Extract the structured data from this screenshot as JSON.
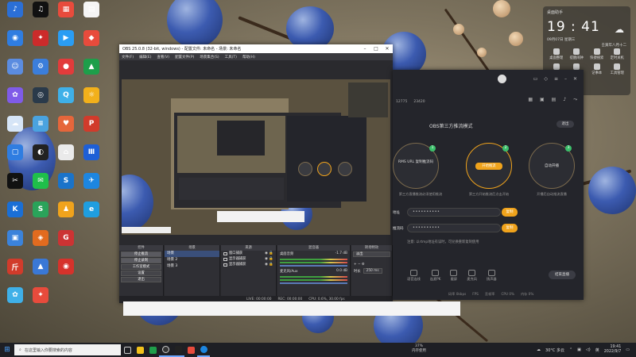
{
  "desktop_icons": [
    {
      "label": "",
      "color": "#2b6fd6",
      "glyph": "♪"
    },
    {
      "label": "",
      "color": "#111111",
      "glyph": "♫"
    },
    {
      "label": "",
      "color": "#e84b3c",
      "glyph": "▦"
    },
    {
      "label": "",
      "color": "#f5f5f5",
      "glyph": "▤"
    },
    {
      "label": "",
      "color": "#2f7de1",
      "glyph": "◉"
    },
    {
      "label": "",
      "color": "#cc2b2b",
      "glyph": "✦"
    },
    {
      "label": "",
      "color": "#2a9df4",
      "glyph": "▶"
    },
    {
      "label": "",
      "color": "#e84b3c",
      "glyph": "◆"
    },
    {
      "label": "",
      "color": "#5b8ce0",
      "glyph": "☺"
    },
    {
      "label": "",
      "color": "#3b7edb",
      "glyph": "⚙"
    },
    {
      "label": "",
      "color": "#e23b3b",
      "glyph": "●"
    },
    {
      "label": "",
      "color": "#1e9e4a",
      "glyph": "▲"
    },
    {
      "label": "",
      "color": "#7f5be8",
      "glyph": "✿"
    },
    {
      "label": "",
      "color": "#2a3a4a",
      "glyph": "◎"
    },
    {
      "label": "",
      "color": "#3fb0e8",
      "glyph": "Q"
    },
    {
      "label": "",
      "color": "#f2b01b",
      "glyph": "☼"
    },
    {
      "label": "",
      "color": "#d6e5f7",
      "glyph": "☁"
    },
    {
      "label": "",
      "color": "#4aa3e0",
      "glyph": "≡"
    },
    {
      "label": "",
      "color": "#e5663b",
      "glyph": "♥"
    },
    {
      "label": "",
      "color": "#d13b2b",
      "glyph": "P"
    },
    {
      "label": "",
      "color": "#2f7de1",
      "glyph": "▢"
    },
    {
      "label": "",
      "color": "#222222",
      "glyph": "◐"
    },
    {
      "label": "",
      "color": "#eaeaea",
      "glyph": "⌂"
    },
    {
      "label": "",
      "color": "#1e5fd6",
      "glyph": "Ⅲ"
    },
    {
      "label": "",
      "color": "#111111",
      "glyph": "✂"
    },
    {
      "label": "",
      "color": "#1fbf4a",
      "glyph": "✉"
    },
    {
      "label": "",
      "color": "#1a73c9",
      "glyph": "S"
    },
    {
      "label": "",
      "color": "#1d86e0",
      "glyph": "✈"
    },
    {
      "label": "",
      "color": "#1a6fd6",
      "glyph": "K"
    },
    {
      "label": "",
      "color": "#2aa35a",
      "glyph": "S"
    },
    {
      "label": "",
      "color": "#f0a31c",
      "glyph": "♟"
    },
    {
      "label": "",
      "color": "#1f9ee0",
      "glyph": "e"
    },
    {
      "label": "",
      "color": "#3b83db",
      "glyph": "▣"
    },
    {
      "label": "",
      "color": "#e26b1f",
      "glyph": "◈"
    },
    {
      "label": "",
      "color": "#cc3333",
      "glyph": "G"
    },
    {
      "label": "",
      "color": "#ffffff",
      "glyph": ""
    },
    {
      "label": "",
      "color": "#d13b2b",
      "glyph": "斤"
    },
    {
      "label": "",
      "color": "#3a78d6",
      "glyph": "▲"
    },
    {
      "label": "",
      "color": "#d6322b",
      "glyph": "◉"
    },
    {
      "label": "",
      "color": "#ffffff",
      "glyph": ""
    },
    {
      "label": "",
      "color": "#3fb0e8",
      "glyph": "✿"
    },
    {
      "label": "",
      "color": "#e84b3c",
      "glyph": "✦"
    },
    {
      "label": "",
      "color": "#ffffff",
      "glyph": ""
    },
    {
      "label": "",
      "color": "#ffffff",
      "glyph": ""
    }
  ],
  "widget": {
    "title": "桌面助手",
    "time": "19 : 41",
    "date": "09月07日 星期三",
    "lunar": "壬寅年八月十二",
    "buttons": [
      "桌面整理",
      "提醒闹钟",
      "快捷搜索",
      "定时关机",
      "",
      "",
      "记事本",
      "工具管理"
    ]
  },
  "obs": {
    "title": "OBS 25.0.8 (32-bit, windows) - 配置文件: 未命名 - 场景: 未命名",
    "menu": [
      "文件(F)",
      "编辑(E)",
      "查看(V)",
      "配置文件(P)",
      "场景集合(S)",
      "工具(T)",
      "帮助(H)"
    ],
    "docks": {
      "controls_header": "控件",
      "scenes_header": "场景",
      "sources_header": "来源",
      "mixer_header": "混音器",
      "transition_header": "转场特效"
    },
    "control_buttons": [
      "停止推流",
      "停止录制",
      "工作室模式",
      "设置",
      "退出"
    ],
    "scenes": [
      "场景",
      "场景 2",
      "场景 3"
    ],
    "sources": [
      "窗口捕获",
      "显示器捕获",
      "显示器捕获"
    ],
    "mixer": [
      {
        "label": "桌面音频",
        "db": "-1.7 dB"
      },
      {
        "label": "麦克风/Aux",
        "db": "0.0 dB"
      }
    ],
    "transition": {
      "value": "淡出",
      "duration_label": "时长",
      "duration": "250 ms"
    },
    "status": [
      "LIVE: 00:00:00",
      "REC: 00:00:00",
      "CPU: 0.6%, 30.00 fps"
    ]
  },
  "tool": {
    "stats": [
      "12775",
      "23420"
    ],
    "heading": "OBS第三方推流模式",
    "exit_label": "退出",
    "steps": [
      {
        "num": "1",
        "text": "RMS URL 复制推流码",
        "desc": "第三方直播推流必须使用推流"
      },
      {
        "num": "2",
        "text": "开始推流",
        "desc": "第三方开始推流后点击开始"
      },
      {
        "num": "3",
        "text": "自动开播",
        "desc": "开播后自动推流直播"
      }
    ],
    "url_label": "地址",
    "key_label": "推流码",
    "url_value": "••••••••••",
    "key_value": "••••••••••",
    "copy_label": "复制",
    "hint": "注意: 以rtmp地址有误时，可兑换重新复制使用",
    "bottom_items": [
      "语音连线",
      "连麦PK",
      "截屏",
      "麦克风",
      "扬声器"
    ],
    "live_label": "结束直播",
    "status": [
      "码率 0kbps",
      "FPS",
      "丢帧率",
      "CPU 0%",
      "内存 0%"
    ]
  },
  "taskbar": {
    "search_placeholder": "在这里输入你要搜索的内容",
    "cpu_percent": "37%",
    "cpu_label": "内存使用",
    "weather": "30°C 多云",
    "ime": "英",
    "time": "19:41",
    "date": "2022/9/7"
  },
  "colors": {
    "accent": "#f0a31c",
    "obs_bg": "#2a2a2e",
    "tool_bg": "#24252b",
    "taskbar_bg": "#1e1f24"
  }
}
